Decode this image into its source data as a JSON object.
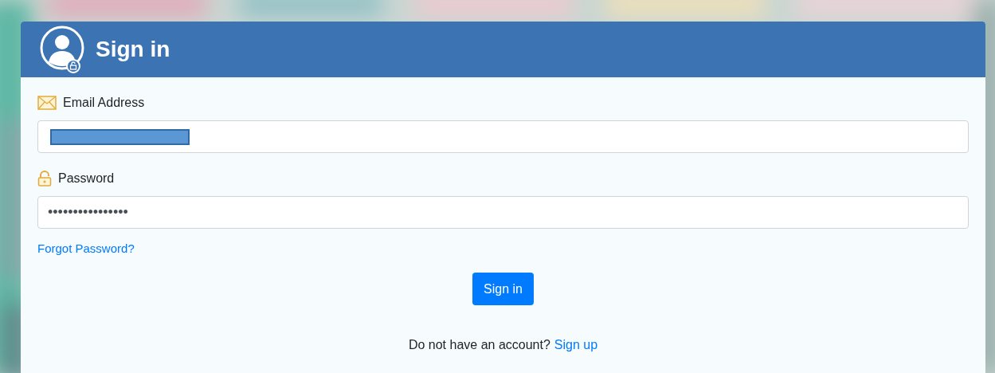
{
  "header": {
    "title": "Sign in"
  },
  "email": {
    "label": "Email Address",
    "redacted": true
  },
  "password": {
    "label": "Password",
    "value": "••••••••••••••••"
  },
  "forgot_link": "Forgot Password?",
  "submit_button": "Sign in",
  "footer": {
    "text": "Do not have an account?",
    "link": "Sign up"
  }
}
